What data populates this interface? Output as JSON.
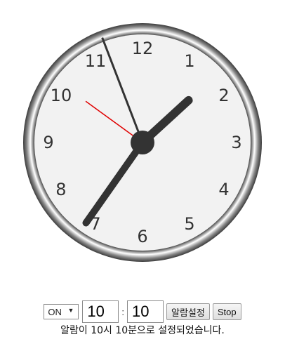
{
  "clock": {
    "numerals": [
      "12",
      "1",
      "2",
      "3",
      "4",
      "5",
      "6",
      "7",
      "8",
      "9",
      "10",
      "11"
    ],
    "time": {
      "hour": 1,
      "minute": 35,
      "second": 51
    },
    "colors": {
      "face": "#f2f2f2",
      "rim": "#444444",
      "hands": "#333333",
      "second_hand": "#e00000"
    }
  },
  "alarm": {
    "mode": "ON",
    "hour": "10",
    "minute": "10",
    "colon": ":",
    "set_label": "알람설정",
    "stop_label": "Stop",
    "status": "알람이 10시 10분으로 설정되었습니다."
  }
}
